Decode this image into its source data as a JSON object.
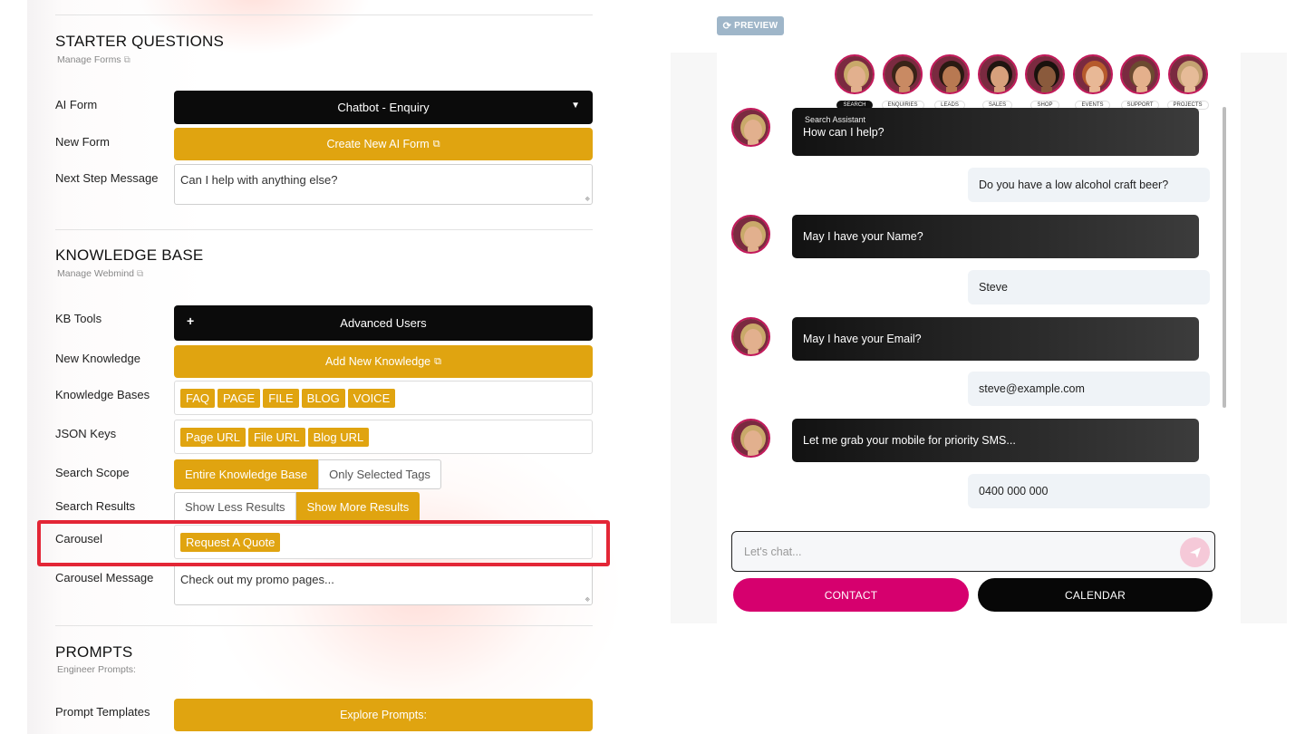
{
  "form": {
    "starter": {
      "title": "STARTER QUESTIONS",
      "subtitle": "Manage Forms",
      "ai_form_label": "AI Form",
      "ai_form_value": "Chatbot - Enquiry",
      "new_form_label": "New Form",
      "new_form_button": "Create New AI Form",
      "next_step_label": "Next Step Message",
      "next_step_value": "Can I help with anything else?"
    },
    "kb": {
      "title": "KNOWLEDGE BASE",
      "subtitle": "Manage Webmind",
      "tools_label": "KB Tools",
      "tools_button": "Advanced Users",
      "new_knowledge_label": "New Knowledge",
      "new_knowledge_button": "Add New Knowledge",
      "bases_label": "Knowledge Bases",
      "bases": [
        "FAQ",
        "PAGE",
        "FILE",
        "BLOG",
        "VOICE"
      ],
      "json_label": "JSON Keys",
      "json_keys": [
        "Page URL",
        "File URL",
        "Blog URL"
      ],
      "scope_label": "Search Scope",
      "scope_options": [
        "Entire Knowledge Base",
        "Only Selected Tags"
      ],
      "scope_selected": "Entire Knowledge Base",
      "results_label": "Search Results",
      "results_options": [
        "Show Less Results",
        "Show More Results"
      ],
      "results_selected": "Show More Results",
      "carousel_label": "Carousel",
      "carousel_tags": [
        "Request A Quote"
      ],
      "carousel_msg_label": "Carousel Message",
      "carousel_msg_value": "Check out my promo pages..."
    },
    "prompts": {
      "title": "PROMPTS",
      "subtitle": "Engineer Prompts:",
      "templates_label": "Prompt Templates",
      "templates_button": "Explore Prompts:"
    }
  },
  "preview": {
    "button": "PREVIEW",
    "agents": [
      {
        "label": "SEARCH",
        "active": true
      },
      {
        "label": "ENQUIRIES",
        "active": false
      },
      {
        "label": "LEADS",
        "active": false
      },
      {
        "label": "SALES",
        "active": false
      },
      {
        "label": "SHOP",
        "active": false
      },
      {
        "label": "EVENTS",
        "active": false
      },
      {
        "label": "SUPPORT",
        "active": false
      },
      {
        "label": "PROJECTS",
        "active": false
      }
    ],
    "messages": [
      {
        "from": "bot",
        "header": "Search Assistant",
        "text": "How can I help?"
      },
      {
        "from": "user",
        "text": "Do you have a low alcohol craft beer?"
      },
      {
        "from": "bot",
        "text": "May I have your Name?"
      },
      {
        "from": "user",
        "text": "Steve"
      },
      {
        "from": "bot",
        "text": "May I have your Email?"
      },
      {
        "from": "user",
        "text": "steve@example.com"
      },
      {
        "from": "bot",
        "text": "Let me grab your mobile for priority SMS..."
      },
      {
        "from": "user",
        "text": "0400 000 000"
      }
    ],
    "input_placeholder": "Let's chat...",
    "contact_button": "CONTACT",
    "calendar_button": "CALENDAR"
  },
  "colors": {
    "gold": "#e0a410",
    "black": "#0b0b0b",
    "highlight": "#e32636",
    "magenta": "#d6006e",
    "avatar_ring": "#c2185b"
  }
}
